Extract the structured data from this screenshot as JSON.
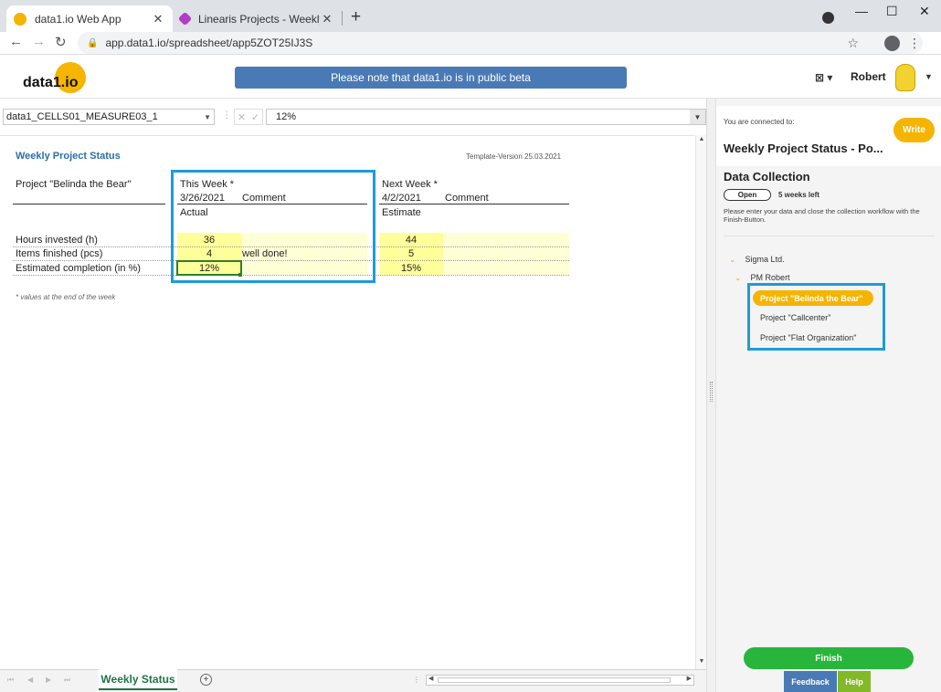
{
  "browser": {
    "tabs": [
      {
        "title": "data1.io Web App",
        "active": true
      },
      {
        "title": "Linearis Projects - Weekly Project",
        "active": false
      }
    ],
    "new_tab_icon": "+",
    "url": "app.data1.io/spreadsheet/app5ZOT25IJ3S",
    "window_controls": [
      "—",
      "☐",
      "✕"
    ]
  },
  "header": {
    "logo": "data1.io",
    "beta_notice": "Please note that data1.io is in public beta",
    "user_name": "Robert",
    "export_icon": "excel-export-icon"
  },
  "formula_bar": {
    "name_box": "data1_CELLS01_MEASURE03_1",
    "value": "12%"
  },
  "sheet": {
    "title": "Weekly Project Status",
    "template_version": "Template-Version 25.03.2021",
    "project_label": "Project \"Belinda the Bear\"",
    "this_week": {
      "header": "This Week *",
      "date": "3/26/2021",
      "comment_header": "Comment",
      "type": "Actual"
    },
    "next_week": {
      "header": "Next Week *",
      "date": "4/2/2021",
      "comment_header": "Comment",
      "type": "Estimate"
    },
    "rows": [
      {
        "label": "Hours invested (h)",
        "actual": "36",
        "comment": "",
        "estimate": "44"
      },
      {
        "label": "Items finished (pcs)",
        "actual": "4",
        "comment": "well done!",
        "estimate": "5"
      },
      {
        "label": "Estimated completion (in %)",
        "actual": "12%",
        "comment": "",
        "estimate": "15%"
      }
    ],
    "footnote": "* values at the end of the week"
  },
  "sheet_tabs": {
    "active": "Weekly Status"
  },
  "panel": {
    "connected_label": "You are connected to:",
    "connected_title": "Weekly Project Status - Po...",
    "write_label": "Write",
    "dc_title": "Data Collection",
    "status": "Open",
    "weeks_left": "5 weeks left",
    "description": "Please enter your data and close the collection workflow with the Finish-Button.",
    "tree": {
      "org": "Sigma Ltd.",
      "manager": "PM Robert",
      "projects": [
        "Project \"Belinda the Bear\"",
        "Project \"Callcenter\"",
        "Project \"Flat Organization\""
      ]
    },
    "finish_label": "Finish",
    "feedback_label": "Feedback",
    "help_label": "Help"
  },
  "colors": {
    "accent_blue": "#4a7ab5",
    "brand_yellow": "#f5b400",
    "finish_green": "#27b53b",
    "help_green": "#83b828",
    "highlight_box": "#1e9bd7",
    "input_yellow": "#ffff99"
  }
}
